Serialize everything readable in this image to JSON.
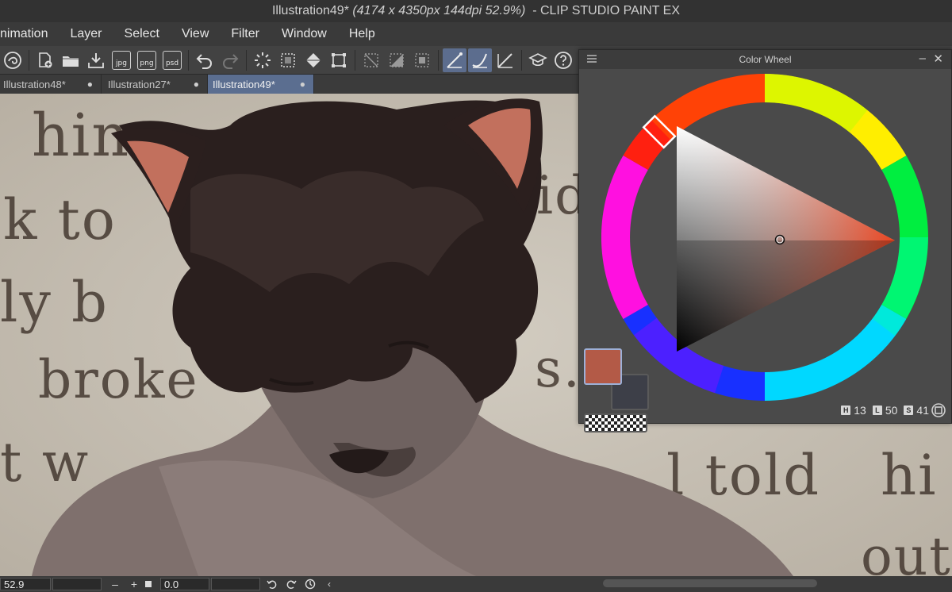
{
  "window": {
    "title_doc": "Illustration49*",
    "title_info": "(4174 x 4350px 144dpi 52.9%)",
    "title_app": "- CLIP STUDIO PAINT EX"
  },
  "menu": [
    "nimation",
    "Layer",
    "Select",
    "View",
    "Filter",
    "Window",
    "Help"
  ],
  "tabs": [
    {
      "label": "Illustration48*",
      "close": "●",
      "active": false
    },
    {
      "label": "Illustration27*",
      "close": "●",
      "active": false
    },
    {
      "label": "Illustration49*",
      "close": "●",
      "active": true
    }
  ],
  "toolbar": {
    "jpg_label": "jpg",
    "png_label": "png",
    "psd_label": "psd"
  },
  "canvas_words": [
    "him",
    "k to",
    "ly b",
    "broke",
    "t w",
    "id",
    "s.",
    "l told",
    "hi",
    "out"
  ],
  "color_wheel": {
    "title": "Color Wheel",
    "minimize": "–",
    "close": "✕",
    "h_label": "H",
    "h_value": "13",
    "l_label": "L",
    "l_value": "50",
    "s_label": "S",
    "s_value": "41",
    "main_color": "#b35a47",
    "sub_color": "#3d3f48"
  },
  "statusbar": {
    "zoom": "52.9",
    "rotation": "0.0",
    "minus": "–",
    "plus": "+"
  }
}
